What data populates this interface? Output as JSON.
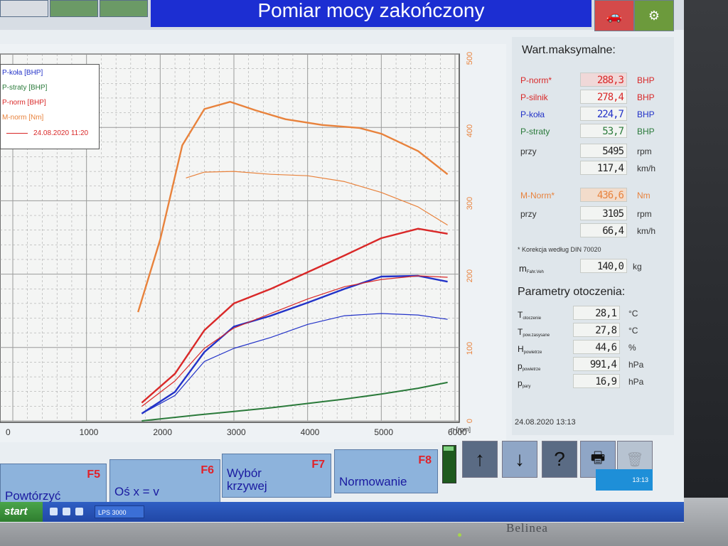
{
  "window": {
    "title": "Pomiar mocy zakończony"
  },
  "colors": {
    "title_bar": "#1c2ed2",
    "p_norm": "#d92828",
    "p_silnik": "#d92828",
    "p_kola": "#2232c8",
    "p_straty": "#2a7a3a",
    "m_norm": "#e8823c",
    "grid": "#9a9a9a"
  },
  "legend": {
    "items": [
      "P-koła [BHP]",
      "P-straty [BHP]",
      "P-norm [BHP]",
      "M-norm [Nm]"
    ],
    "date": "24.08.2020 11:20"
  },
  "chart_data": {
    "type": "line",
    "xlabel": "n [rpm]",
    "x_ticks": [
      "0",
      "1000",
      "2000",
      "3000",
      "4000",
      "5000",
      "6000"
    ],
    "xlim": [
      0,
      6000
    ],
    "y_ticks_right": [
      "0",
      "100",
      "200",
      "300",
      "400",
      "500"
    ],
    "grid": true,
    "legend_placement": "top-left",
    "series": [
      {
        "name": "P-norm [BHP]",
        "x": [
          1750,
          2200,
          2600,
          3000,
          3500,
          4000,
          4500,
          5000,
          5500,
          5900
        ],
        "y": [
          25,
          65,
          125,
          162,
          182,
          205,
          228,
          252,
          265,
          258
        ]
      },
      {
        "name": "P-koła [BHP]",
        "x": [
          1750,
          2200,
          2600,
          3000,
          3500,
          4000,
          4500,
          5000,
          5500,
          5900
        ],
        "y": [
          10,
          40,
          95,
          130,
          145,
          163,
          182,
          199,
          200,
          192
        ]
      },
      {
        "name": "P-straty [BHP]",
        "x": [
          1750,
          2500,
          3000,
          3500,
          4000,
          4500,
          5000,
          5500,
          5900
        ],
        "y": [
          0,
          8,
          13,
          18,
          24,
          30,
          37,
          45,
          53
        ]
      },
      {
        "name": "M-norm [Nm]",
        "x": [
          1700,
          2000,
          2300,
          2600,
          2950,
          3300,
          3700,
          4200,
          4700,
          5000,
          5500,
          5900
        ],
        "y": [
          150,
          250,
          380,
          430,
          440,
          428,
          416,
          408,
          404,
          396,
          372,
          340
        ]
      },
      {
        "x": [
          1750,
          2200,
          2600,
          3000,
          3500,
          4000,
          4500,
          5000,
          5500,
          5900
        ],
        "y": [
          20,
          55,
          100,
          128,
          148,
          168,
          185,
          195,
          200,
          198
        ]
      },
      {
        "x": [
          1750,
          2200,
          2600,
          3000,
          3500,
          4000,
          4500,
          5000,
          5500,
          5900
        ],
        "y": [
          10,
          35,
          82,
          100,
          115,
          133,
          145,
          148,
          146,
          140
        ]
      },
      {
        "x": [
          2350,
          2600,
          3000,
          3500,
          4000,
          4500,
          5000,
          5500,
          5900
        ],
        "y": [
          335,
          343,
          344,
          340,
          338,
          330,
          315,
          295,
          270
        ]
      }
    ]
  },
  "right_panel": {
    "max_title": "Wart.maksymalne:",
    "rows": [
      {
        "label": "P-norm*",
        "value": "288,3",
        "unit": "BHP"
      },
      {
        "label": "P-silnik",
        "value": "278,4",
        "unit": "BHP"
      },
      {
        "label": "P-koła",
        "value": "224,7",
        "unit": "BHP"
      },
      {
        "label": "P-straty",
        "value": "53,7",
        "unit": "BHP"
      },
      {
        "label": "przy",
        "value": "5495",
        "unit": "rpm"
      },
      {
        "label": "",
        "value": "117,4",
        "unit": "km/h"
      }
    ],
    "torque_rows": [
      {
        "label": "M-Norm*",
        "value": "436,6",
        "unit": "Nm"
      },
      {
        "label": "przy",
        "value": "3105",
        "unit": "rpm"
      },
      {
        "label": "",
        "value": "66,4",
        "unit": "km/h"
      }
    ],
    "correction_note": "* Korekcja według DIN 70020",
    "mass": {
      "label": "m",
      "sub": "Fahr.Veh",
      "value": "140,0",
      "unit": "kg"
    },
    "ambient_title": "Parametry otoczenia:",
    "ambient": [
      {
        "label": "T",
        "sub": "otoczenie",
        "value": "28,1",
        "unit": "°C"
      },
      {
        "label": "T",
        "sub": "pow.zasysane",
        "value": "27,8",
        "unit": "°C"
      },
      {
        "label": "H",
        "sub": "powietrze",
        "value": "44,6",
        "unit": "%"
      },
      {
        "label": "p",
        "sub": "powietrze",
        "value": "991,4",
        "unit": "hPa"
      },
      {
        "label": "p",
        "sub": "pary",
        "value": "16,9",
        "unit": "hPa"
      }
    ],
    "timestamp": "24.08.2020  13:13"
  },
  "function_keys": [
    {
      "key": "F5",
      "label": "Powtórzyć"
    },
    {
      "key": "F6",
      "label": "Oś x = v"
    },
    {
      "key": "F7",
      "label": "Wybór krzywej"
    },
    {
      "key": "F8",
      "label": "Normowanie"
    }
  ],
  "nav_buttons": [
    {
      "name": "arrow-up",
      "glyph": "↑"
    },
    {
      "name": "arrow-down",
      "glyph": "↓"
    },
    {
      "name": "help",
      "glyph": "?"
    },
    {
      "name": "print",
      "glyph": "🖶"
    },
    {
      "name": "trash",
      "glyph": "🗑"
    }
  ],
  "taskbar": {
    "start": "start",
    "task": "LPS 3000",
    "clock": "13:13"
  },
  "monitor": {
    "brand": "Belinea"
  }
}
